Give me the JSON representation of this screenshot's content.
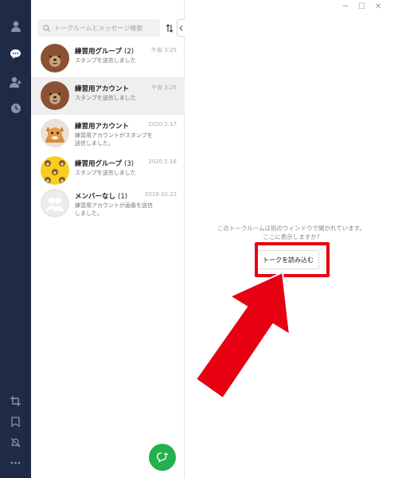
{
  "search": {
    "placeholder": "トークルームとメッセージ検索"
  },
  "chats": [
    {
      "name": "練習用グループ",
      "count": "(2)",
      "preview": "スタンプを送信しました",
      "time": "午後 3:25",
      "avatar": "bear-avatar",
      "active": false
    },
    {
      "name": "練習用アカウント",
      "count": "",
      "preview": "スタンプを送信しました",
      "time": "午後 3:25",
      "avatar": "bear-avatar",
      "active": true
    },
    {
      "name": "練習用アカウント",
      "count": "",
      "preview": "練習用アカウントがスタンプを送信しました。",
      "time": "2020.5.17",
      "avatar": "cat-photo-avatar",
      "active": false
    },
    {
      "name": "練習用グループ",
      "count": "(3)",
      "preview": "スタンプを送信しました",
      "time": "2020.5.16",
      "avatar": "bear-pattern-avatar",
      "active": false
    },
    {
      "name": "メンバーなし",
      "count": "(1)",
      "preview": "練習用アカウントが画像を送信しました。",
      "time": "2019.10.22",
      "avatar": "empty-group-avatar",
      "active": false
    }
  ],
  "content": {
    "info_line1": "このトークルームは別のウィンドウで開かれています。",
    "info_line2": "ここに表示しますか?",
    "load_button": "トークを読み込む"
  },
  "colors": {
    "rail_bg": "#1f2a46",
    "fab_green": "#22b14c",
    "annotation_red": "#e60012"
  },
  "icons": {
    "rail_top": [
      "profile-icon",
      "chat-icon",
      "add-friend-icon",
      "clock-icon"
    ],
    "rail_bottom": [
      "crop-icon",
      "bookmark-icon",
      "mute-bell-icon",
      "more-icon"
    ]
  }
}
